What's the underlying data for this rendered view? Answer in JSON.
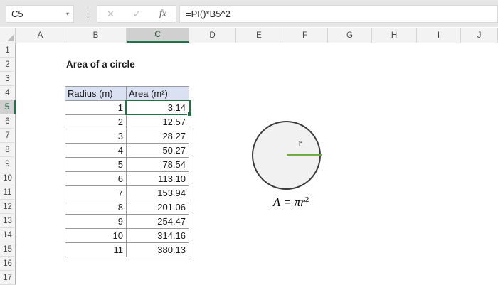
{
  "formula_bar": {
    "name_box_value": "C5",
    "dropdown_icon": "▾",
    "separator_dots": "⋮",
    "cancel_icon": "✕",
    "enter_icon": "✓",
    "insert_function_label": "fx",
    "formula": "=PI()*B5^2"
  },
  "grid": {
    "column_headers": [
      "A",
      "B",
      "C",
      "D",
      "E",
      "F",
      "G",
      "H",
      "I",
      "J"
    ],
    "row_headers": [
      "1",
      "2",
      "3",
      "4",
      "5",
      "6",
      "7",
      "8",
      "9",
      "10",
      "11",
      "12",
      "13",
      "14",
      "15",
      "16",
      "17"
    ],
    "selected_cell": "C5",
    "selected_column": "C",
    "selected_row": "5"
  },
  "sheet": {
    "title": "Area of a circle",
    "table": {
      "headers": [
        "Radius (m)",
        "Area (m²)"
      ],
      "rows": [
        [
          "1",
          "3.14"
        ],
        [
          "2",
          "12.57"
        ],
        [
          "3",
          "28.27"
        ],
        [
          "4",
          "50.27"
        ],
        [
          "5",
          "78.54"
        ],
        [
          "6",
          "113.10"
        ],
        [
          "7",
          "153.94"
        ],
        [
          "8",
          "201.06"
        ],
        [
          "9",
          "254.47"
        ],
        [
          "10",
          "314.16"
        ],
        [
          "11",
          "380.13"
        ]
      ]
    },
    "diagram": {
      "radius_label": "r",
      "equation_lhs": "A",
      "equation_equals": "=",
      "equation_rhs": "πr",
      "equation_exponent": "2"
    }
  },
  "colors": {
    "selection_green": "#217346",
    "radius_line_green": "#70ad47",
    "table_header_fill": "#d9e1f2",
    "topbar_gray": "#e6e6e6"
  }
}
